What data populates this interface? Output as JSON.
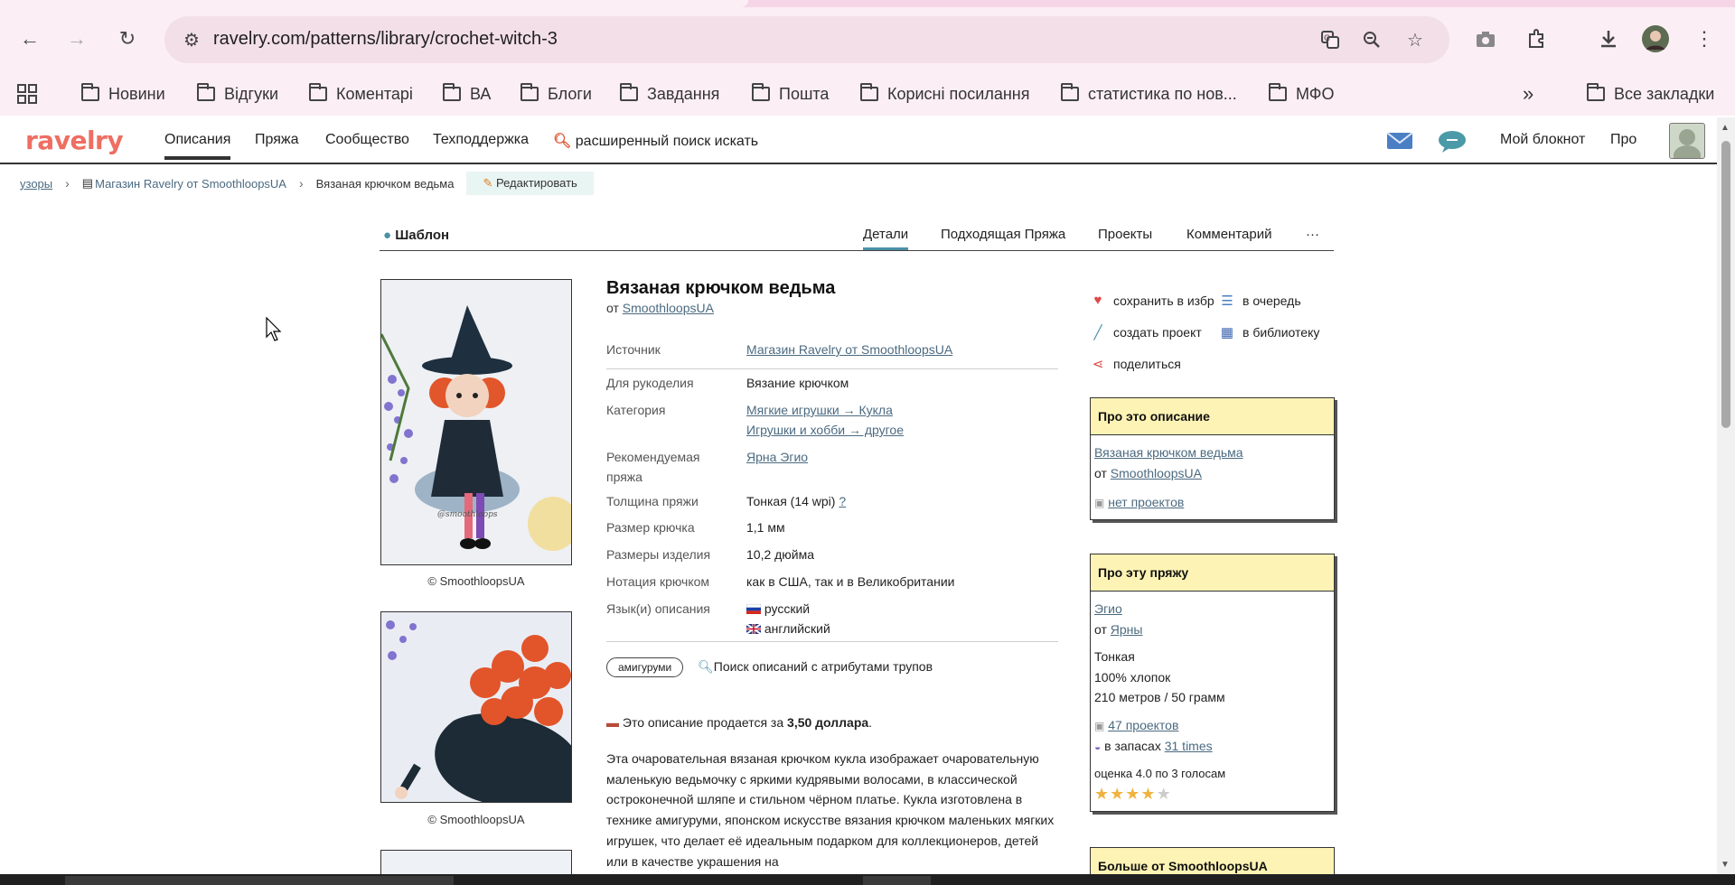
{
  "browser": {
    "url": "ravelry.com/patterns/library/crochet-witch-3",
    "bookmarks": [
      "Новини",
      "Відгуки",
      "Коментарі",
      "ВА",
      "Блоги",
      "Завдання",
      "Пошта",
      "Корисні посилання",
      "статистика по нов...",
      "МФО"
    ],
    "all_bookmarks": "Все закладки",
    "more_glyph": "»"
  },
  "site": {
    "logo": "ravelry",
    "nav": [
      "Описания",
      "Пряжа",
      "Сообщество",
      "Техподдержка"
    ],
    "search_label": "расширенный поиск искать",
    "notebook": "Мой блокнот",
    "pro": "Про",
    "colors": {
      "logo": "#ee6e62",
      "link": "#4b6a80",
      "box_header": "#fdf3b4",
      "tab_accent": "#4a90a8"
    }
  },
  "breadcrumb": {
    "root": "узоры",
    "store": "Магазин Ravelry от SmoothloopsUA",
    "current": "Вязаная крючком ведьма",
    "edit": "Редактировать"
  },
  "tabs": {
    "kind": "Шаблон",
    "items": [
      "Детали",
      "Подходящая Пряжа",
      "Проекты",
      "Комментарий"
    ],
    "more": "···"
  },
  "photos": {
    "caption": "© SmoothloopsUA",
    "watermark": "@smoothloops"
  },
  "pattern": {
    "title": "Вязаная крючком ведьма",
    "by_prefix": "от",
    "designer": "SmoothloopsUA",
    "details": [
      {
        "label": "Источник",
        "values": [
          "Магазин Ravelry от SmoothloopsUA"
        ],
        "link": true
      },
      {
        "label": "Для рукоделия",
        "values": [
          "Вязание крючком"
        ],
        "link": false
      },
      {
        "label": "Категория",
        "values": [
          "Мягкие игрушки → Кукла",
          "Игрушки и хобби → другое"
        ],
        "link": true
      },
      {
        "label": "Рекомендуемая пряжа",
        "values": [
          "Ярна Эгио"
        ],
        "link": true
      },
      {
        "label": "Толщина пряжи",
        "values": [
          "Тонкая (14 wpi)"
        ],
        "help": "?",
        "link": false
      },
      {
        "label": "Размер крючка",
        "values": [
          "1,1 мм"
        ],
        "link": false
      },
      {
        "label": "Размеры изделия",
        "values": [
          "10,2 дюйма"
        ],
        "link": false
      },
      {
        "label": "Нотация крючком",
        "values": [
          "как в США, так и в Великобритании"
        ],
        "link": false
      },
      {
        "label": "Язык(и) описания",
        "values": [
          "русский",
          "английский"
        ],
        "link": false
      }
    ],
    "tag": "амигуруми",
    "attr_search": "Поиск описаний с атрибутами трупов",
    "price_prefix": "Это описание продается за",
    "price": "3,50 доллара",
    "price_suffix": ".",
    "description": "Эта очаровательная вязаная крючком кукла изображает очаровательную маленькую ведьмочку с яркими кудрявыми волосами, в классической остроконечной шляпе и стильном чёрном платье. Кукла изготовлена в технике амигуруми, японском искусстве вязания крючком маленьких мягких игрушек, что делает её идеальным подарком для коллекционеров, детей или в качестве украшения на"
  },
  "actions": {
    "save": "сохранить в избр",
    "queue": "в очередь",
    "create_project": "создать проект",
    "library": "в библиотеку",
    "share": "поделиться"
  },
  "about_pattern": {
    "header": "Про это описание",
    "name": "Вязаная крючком ведьма",
    "by_prefix": "от",
    "designer": "SmoothloopsUA",
    "projects": "нет проектов"
  },
  "about_yarn": {
    "header": "Про эту пряжу",
    "name": "Эгио",
    "by_prefix": "от",
    "brand": "Ярны",
    "weight": "Тонкая",
    "fiber": "100% хлопок",
    "yardage": "210 метров / 50 грамм",
    "projects": "47 проектов",
    "stash_prefix": "в запасах",
    "stash": "31 times",
    "rating_text": "оценка 4.0 по 3 голосам",
    "rating": 4,
    "rating_max": 5
  },
  "more_from": {
    "header": "Больше от SmoothloopsUA"
  }
}
